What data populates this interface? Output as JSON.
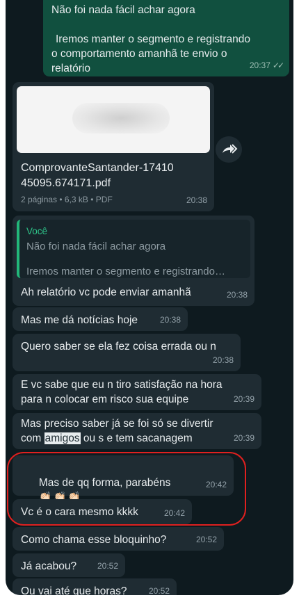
{
  "messages": {
    "out1": {
      "line1": "Não foi nada fácil achar agora",
      "line2": "Iremos manter o segmento e registrando",
      "line3": "o comportamento amanhã te  envio o",
      "line4": "relatório",
      "time": "20:37",
      "ticks": "✓✓"
    },
    "doc": {
      "file_line1": "ComprovanteSantander-17410",
      "file_line2": "45095.674171.pdf",
      "meta": "2 páginas • 6,3 kB • PDF",
      "time": "20:38"
    },
    "reply": {
      "quote_author": "Você",
      "quote_line1": "Não foi nada fácil achar agora",
      "quote_line2": "Iremos manter o segmento e registrando…",
      "text": "Ah relatório vc pode enviar amanhã",
      "time": "20:38"
    },
    "m1": {
      "text": "Mas me dá notícias hoje",
      "time": "20:38"
    },
    "m2": {
      "text": "Quero saber se ela fez coisa errada ou n",
      "time": "20:38"
    },
    "m3": {
      "line1": "E vc sabe que eu n tiro satisfação na hora",
      "line2": "para n colocar em risco sua equipe",
      "time": "20:39"
    },
    "m4": {
      "line1": "Mas preciso saber já se foi só se divertir",
      "line2_pre": "com ",
      "line2_hl": "amigos",
      "line2_post": " ou s e tem sacanagem",
      "time": "20:39"
    },
    "m5": {
      "text": "Mas de qq forma, parabéns",
      "emoji": "👏🏻👏🏻👏🏻",
      "time": "20:42"
    },
    "m6": {
      "text": "Vc é o cara mesmo kkkk",
      "time": "20:42"
    },
    "m7": {
      "text": "Como chama esse bloquinho?",
      "time": "20:52"
    },
    "m8": {
      "text": "Já acabou?",
      "time": "20:52"
    },
    "m9": {
      "text": "Ou vai até que horas?",
      "time": "20:52"
    }
  },
  "icons": {
    "forward": "forward-icon"
  },
  "colors": {
    "incoming": "#1f2c33",
    "outgoing": "#11503f",
    "highlight_ring": "#e0201f",
    "quote_accent": "#22b77a"
  }
}
